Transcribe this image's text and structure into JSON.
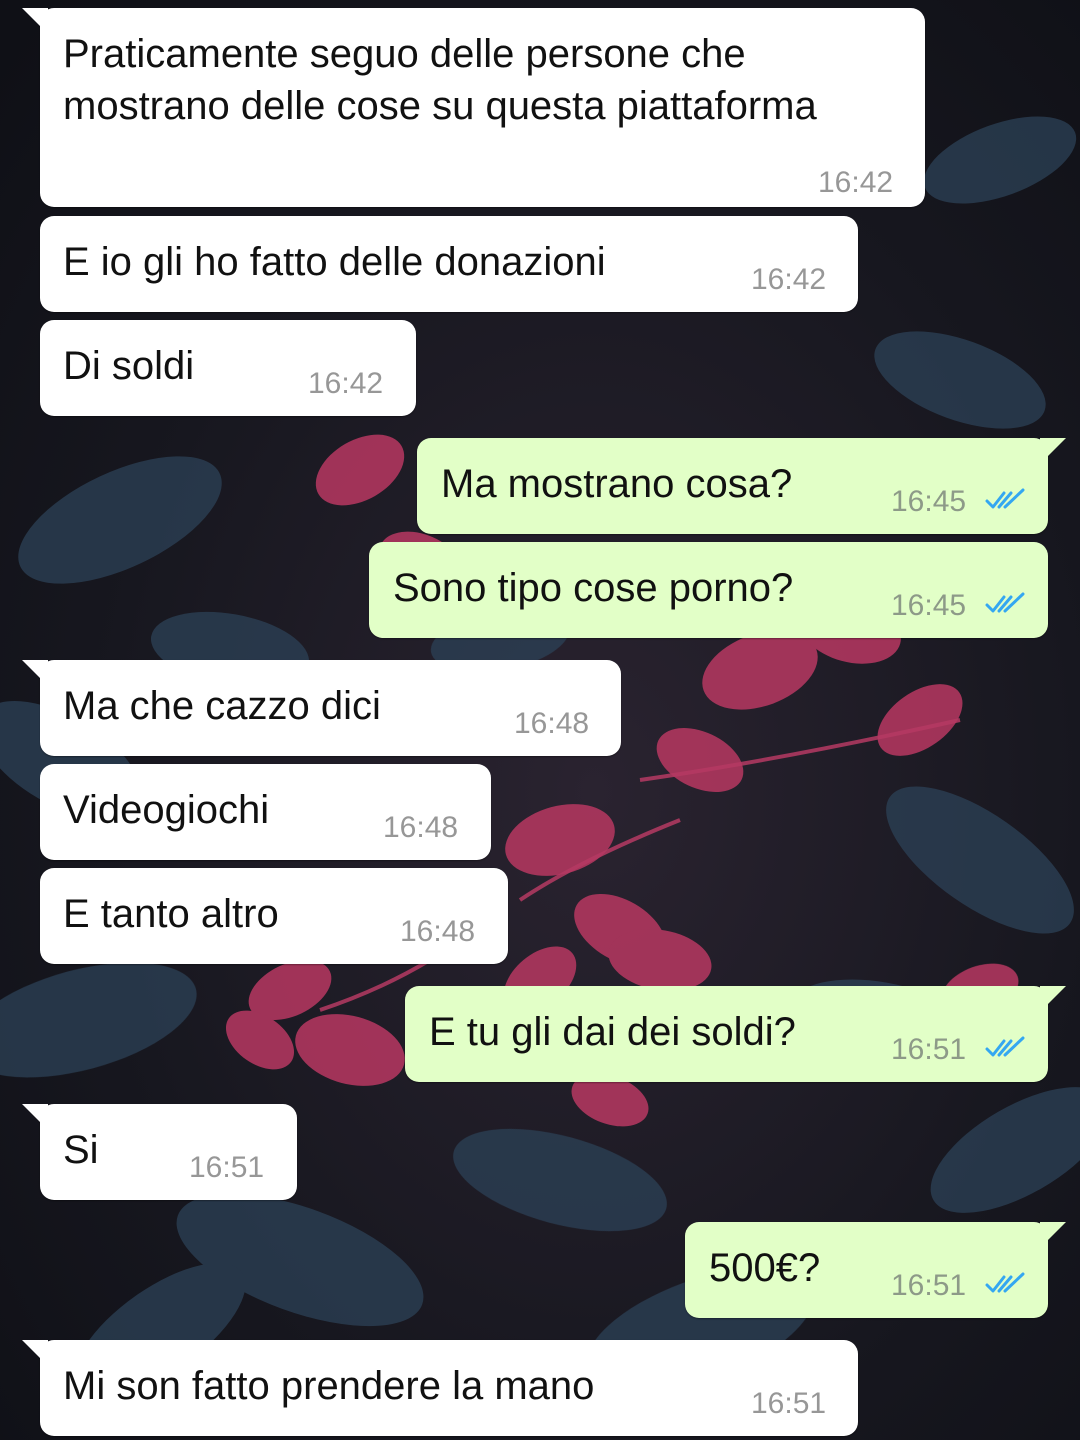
{
  "colors": {
    "incoming_bubble": "#ffffff",
    "outgoing_bubble": "#e2ffc7",
    "read_ticks": "#34a7f1",
    "timestamp": "#979797"
  },
  "messages": [
    {
      "direction": "incoming",
      "text": "Praticamente seguo delle persone che\nmostrano delle cose su questa piattaforma",
      "time": "16:42"
    },
    {
      "direction": "incoming",
      "text": "E io gli ho fatto delle donazioni",
      "time": "16:42"
    },
    {
      "direction": "incoming",
      "text": "Di soldi",
      "time": "16:42"
    },
    {
      "direction": "outgoing",
      "text": "Ma mostrano cosa?",
      "time": "16:45",
      "status_icon": "double-check-icon"
    },
    {
      "direction": "outgoing",
      "text": "Sono tipo cose porno?",
      "time": "16:45",
      "status_icon": "double-check-icon"
    },
    {
      "direction": "incoming",
      "text": "Ma che cazzo dici",
      "time": "16:48"
    },
    {
      "direction": "incoming",
      "text": "Videogiochi",
      "time": "16:48"
    },
    {
      "direction": "incoming",
      "text": "E tanto altro",
      "time": "16:48"
    },
    {
      "direction": "outgoing",
      "text": "E tu gli dai dei soldi?",
      "time": "16:51",
      "status_icon": "double-check-icon"
    },
    {
      "direction": "incoming",
      "text": "Si",
      "time": "16:51"
    },
    {
      "direction": "outgoing",
      "text": "500€?",
      "time": "16:51",
      "status_icon": "double-check-icon"
    },
    {
      "direction": "incoming",
      "text": "Mi son fatto prendere la mano",
      "time": "16:51"
    }
  ]
}
